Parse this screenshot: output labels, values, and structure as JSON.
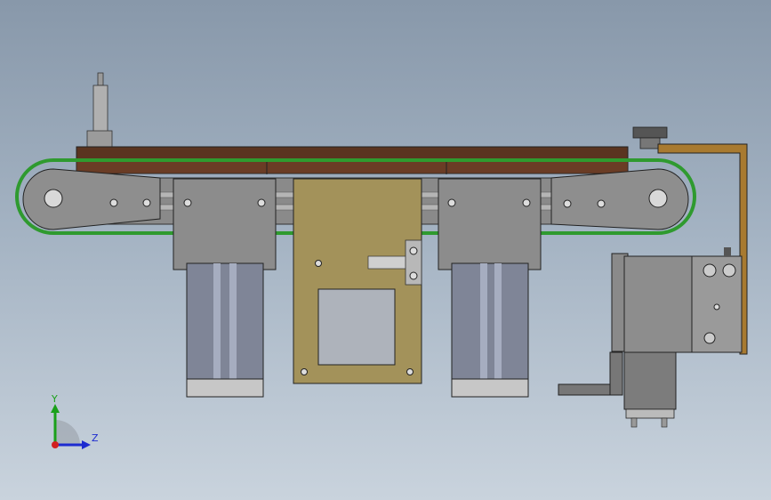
{
  "viewport": {
    "background_top": "#8898aa",
    "background_bottom": "#c9d3dd"
  },
  "model": {
    "colors": {
      "conveyor_top": "#5a3420",
      "belt": "#2f9a2f",
      "steel": "#8e8e8e",
      "motor_body": "#7f8597",
      "plate": "#a3925a",
      "bracket": "#a87a30"
    }
  },
  "triad": {
    "y_label": "Y",
    "z_label": "Z",
    "y_icon": "y-axis-arrow-icon",
    "z_icon": "z-axis-arrow-icon"
  }
}
